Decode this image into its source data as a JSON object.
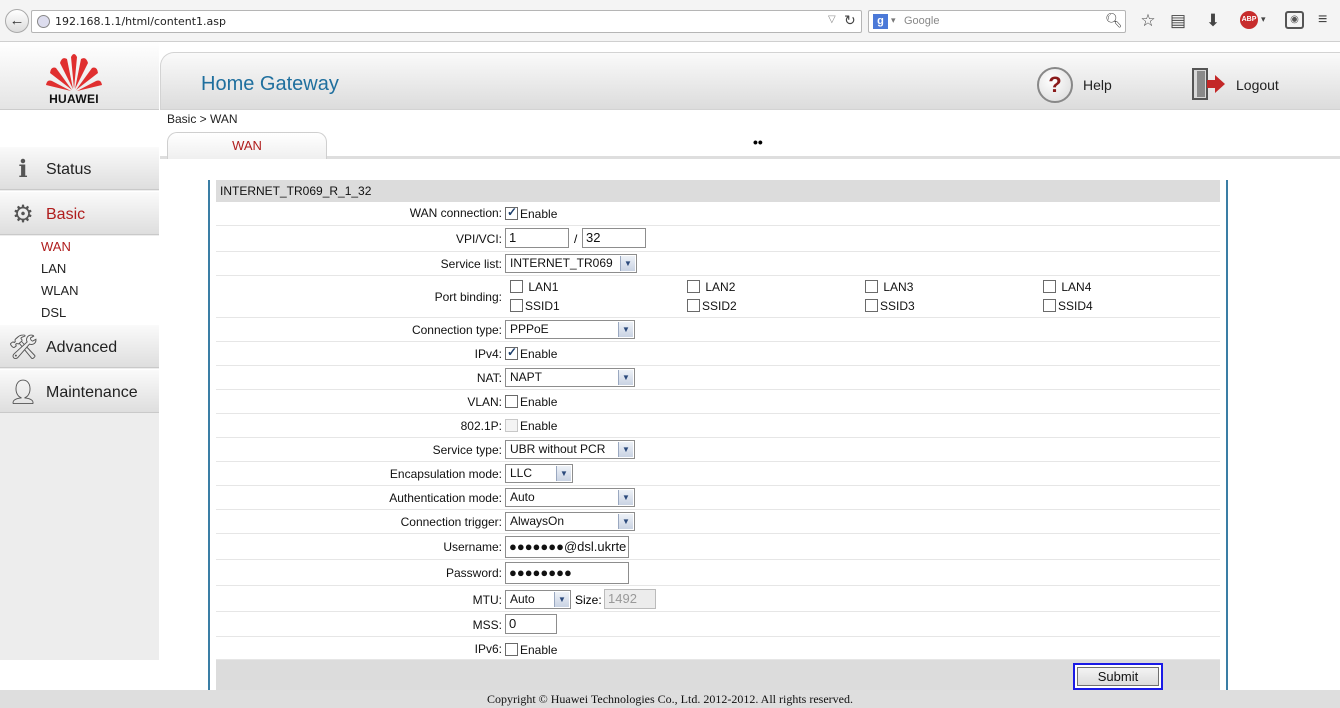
{
  "browser": {
    "url": "192.168.1.1/html/content1.asp",
    "search_placeholder": "Google"
  },
  "brand": {
    "logo_text": "HUAWEI",
    "accent_red": "#e02f2f"
  },
  "header": {
    "title": "Home Gateway",
    "help_label": "Help",
    "logout_label": "Logout"
  },
  "sidebar": {
    "items": [
      {
        "label": "Status",
        "icon": "status-icon"
      },
      {
        "label": "Basic",
        "icon": "basic-gear-icon",
        "active": true
      },
      {
        "label": "Advanced",
        "icon": "advanced-tools-icon"
      },
      {
        "label": "Maintenance",
        "icon": "maintenance-user-icon"
      }
    ],
    "subitems": [
      "WAN",
      "LAN",
      "WLAN",
      "DSL"
    ]
  },
  "breadcrumb": "Basic > WAN",
  "tabs": [
    {
      "label": "WAN",
      "active": true
    }
  ],
  "form": {
    "title": "INTERNET_TR069_R_1_32",
    "wan_connection": {
      "label": "WAN connection:",
      "checked": true,
      "option": "Enable"
    },
    "vpi_vci": {
      "label": "VPI/VCI:",
      "vpi": "1",
      "separator": "/",
      "vci": "32"
    },
    "service_list": {
      "label": "Service list:",
      "value": "INTERNET_TR069"
    },
    "port_binding": {
      "label": "Port binding:",
      "ports": [
        "LAN1",
        "LAN2",
        "LAN3",
        "LAN4",
        "SSID1",
        "SSID2",
        "SSID3",
        "SSID4"
      ]
    },
    "connection_type": {
      "label": "Connection type:",
      "value": "PPPoE"
    },
    "ipv4": {
      "label": "IPv4:",
      "checked": true,
      "option": "Enable"
    },
    "nat": {
      "label": "NAT:",
      "value": "NAPT"
    },
    "vlan": {
      "label": "VLAN:",
      "checked": false,
      "option": "Enable"
    },
    "dot1p": {
      "label": "802.1P:",
      "checked": false,
      "disabled": true,
      "option": "Enable"
    },
    "service_type": {
      "label": "Service type:",
      "value": "UBR without PCR"
    },
    "encapsulation": {
      "label": "Encapsulation mode:",
      "value": "LLC"
    },
    "authentication": {
      "label": "Authentication mode:",
      "value": "Auto"
    },
    "connection_trigger": {
      "label": "Connection trigger:",
      "value": "AlwaysOn"
    },
    "username": {
      "label": "Username:",
      "value": "●●●●●●●@dsl.ukrte"
    },
    "password": {
      "label": "Password:",
      "value": "●●●●●●●●"
    },
    "mtu": {
      "label": "MTU:",
      "value": "Auto",
      "size_label": "Size:",
      "size_value": "1492"
    },
    "mss": {
      "label": "MSS:",
      "value": "0"
    },
    "ipv6": {
      "label": "IPv6:",
      "checked": false,
      "option": "Enable"
    },
    "submit_label": "Submit"
  },
  "footer": {
    "copyright": "Copyright © Huawei Technologies Co., Ltd. 2012-2012. All rights reserved."
  }
}
